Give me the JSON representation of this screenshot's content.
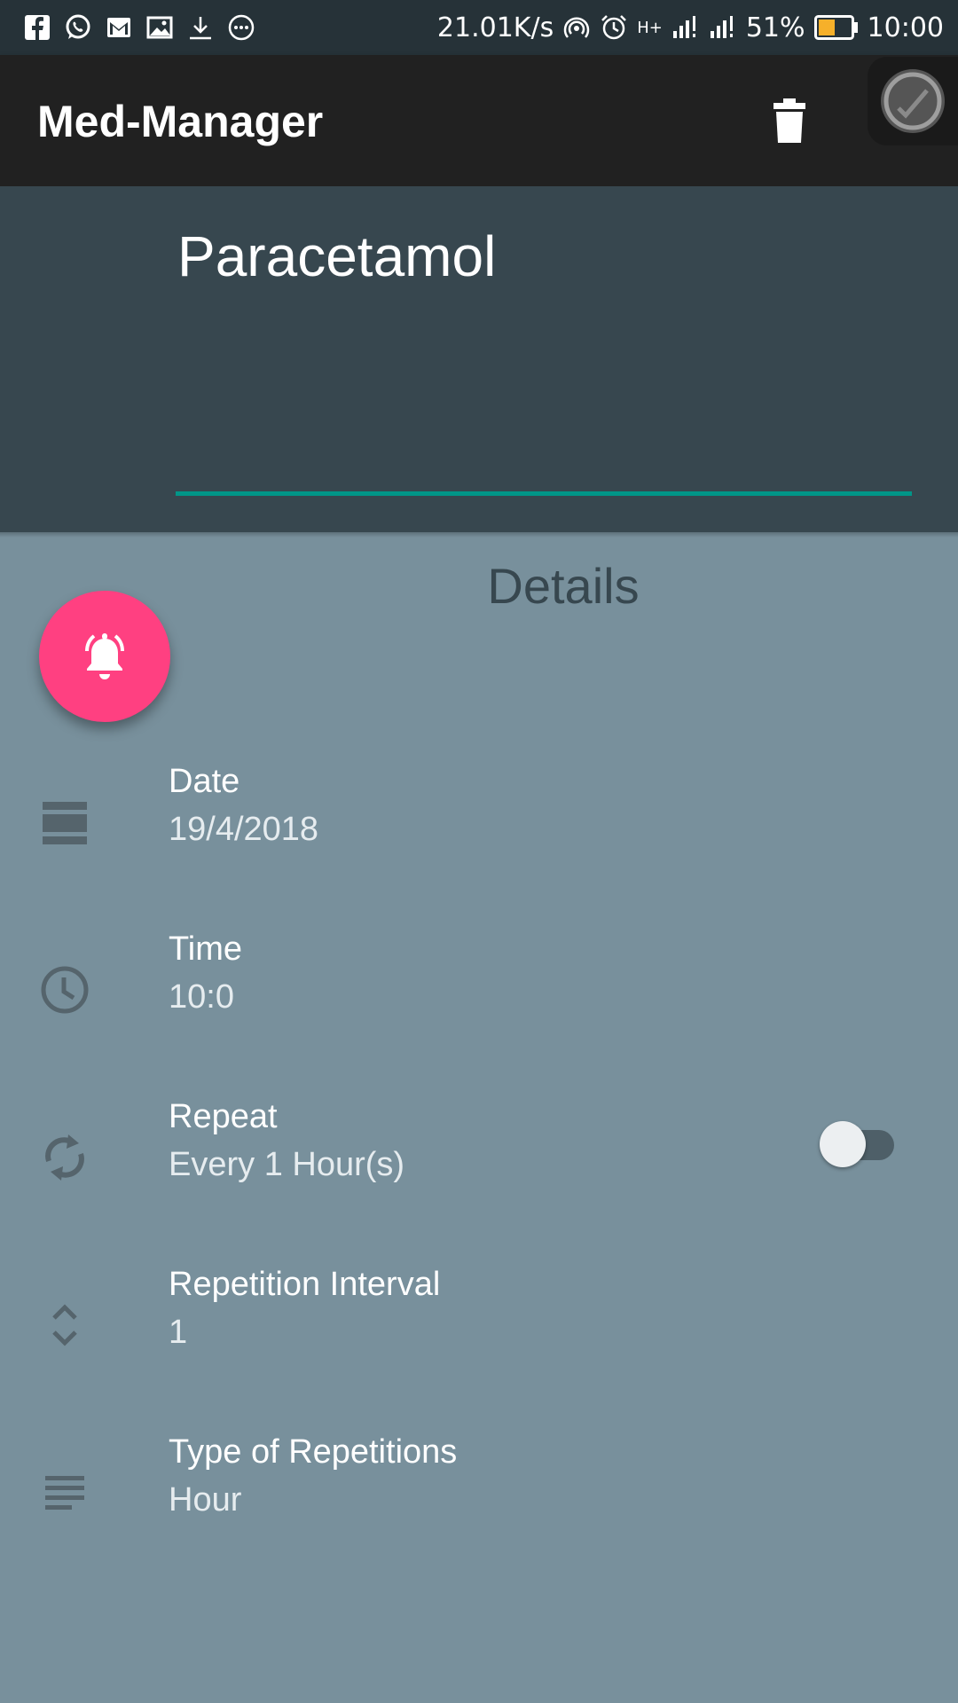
{
  "status_bar": {
    "net_speed": "21.01K/s",
    "network_type": "H+",
    "battery_percent": "51%",
    "battery_level": 0.51,
    "time": "10:00",
    "left_icons": [
      "facebook-icon",
      "whatsapp-icon",
      "gmail-icon",
      "gallery-icon",
      "download-icon",
      "more-icon"
    ],
    "right_icons": [
      "hotspot-icon",
      "alarm-icon",
      "signal-icon",
      "signal-icon",
      "battery-icon"
    ]
  },
  "toolbar": {
    "title": "Med-Manager",
    "delete_icon": "trash-icon",
    "save_icon": "check-icon"
  },
  "header": {
    "medicine_name": "Paracetamol"
  },
  "details": {
    "heading": "Details",
    "fab_icon": "alarm-bell-icon",
    "rows": [
      {
        "label": "Date",
        "value": "19/4/2018",
        "icon": "calendar-icon"
      },
      {
        "label": "Time",
        "value": "10:0",
        "icon": "clock-icon"
      },
      {
        "label": "Repeat",
        "value": "Every 1 Hour(s)",
        "icon": "repeat-icon"
      },
      {
        "label": "Repetition Interval",
        "value": "1",
        "icon": "unfold-icon"
      },
      {
        "label": "Type of Repetitions",
        "value": "Hour",
        "icon": "subject-icon"
      }
    ],
    "repeat_toggle_on": false
  },
  "colors": {
    "status_bar": "#263238",
    "toolbar": "#212121",
    "header": "#37474f",
    "body": "#78909c",
    "accent_underline": "#009688",
    "fab": "#ff4081"
  }
}
